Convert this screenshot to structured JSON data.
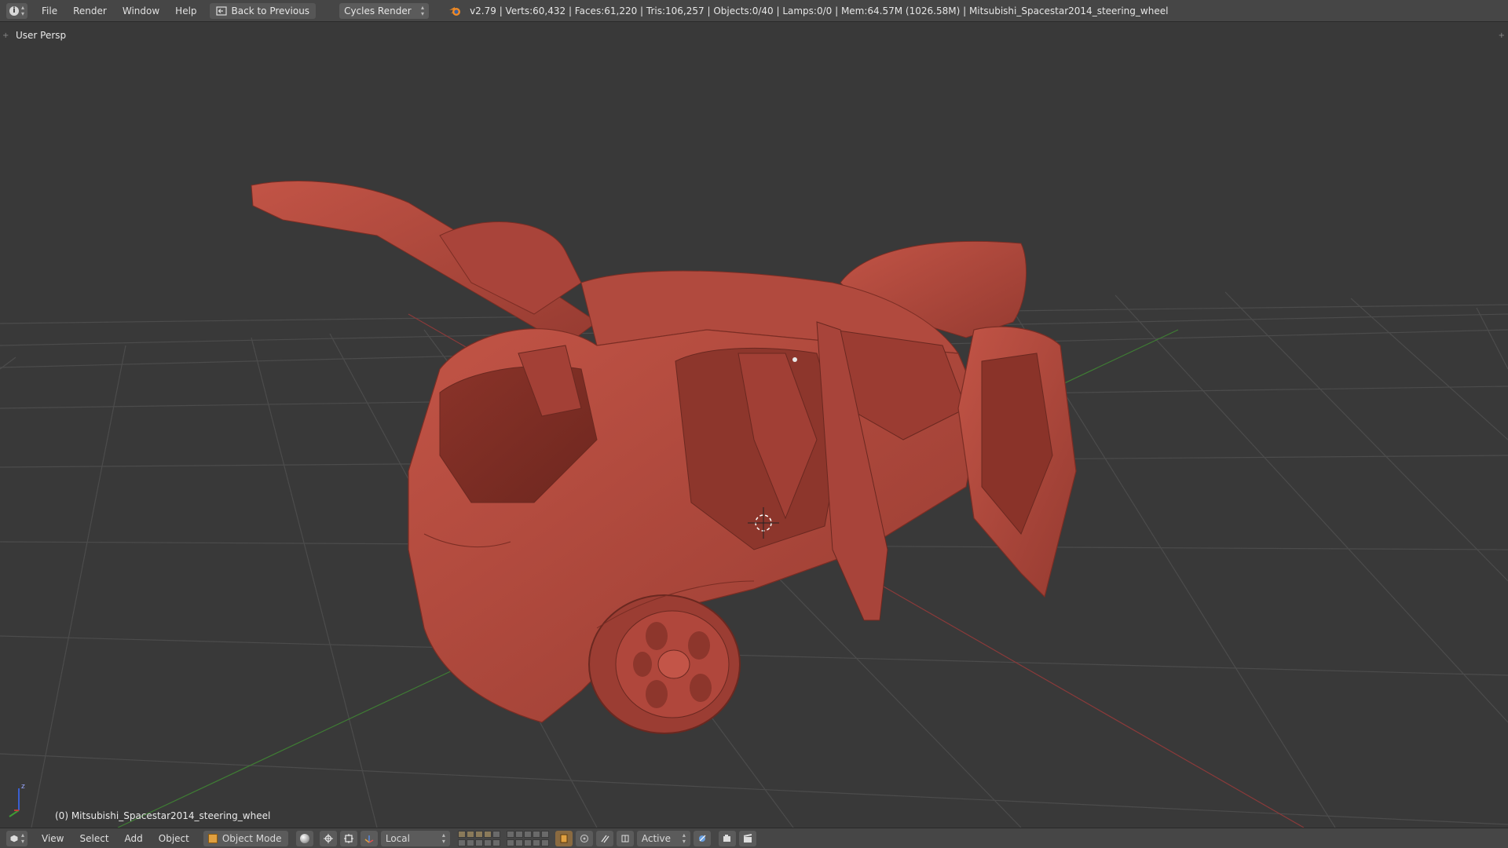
{
  "top_header": {
    "editor_type_icon": "info-icon",
    "menu": [
      "File",
      "Render",
      "Window",
      "Help"
    ],
    "back_button": "Back to Previous",
    "render_engine": "Cycles Render",
    "stats": "v2.79 | Verts:60,432 | Faces:61,220 | Tris:106,257 | Objects:0/40 | Lamps:0/0 | Mem:64.57M (1026.58M) | Mitsubishi_Spacestar2014_steering_wheel"
  },
  "viewport": {
    "view_label": "User Persp",
    "object_label": "(0) Mitsubishi_Spacestar2014_steering_wheel",
    "model_color": "#b1473c",
    "background_color": "#393939"
  },
  "bottom_header": {
    "editor_type_icon": "cube-icon",
    "menu": [
      "View",
      "Select",
      "Add",
      "Object"
    ],
    "mode": "Object Mode",
    "transform_orientation": "Local",
    "snap_target": "Active"
  }
}
